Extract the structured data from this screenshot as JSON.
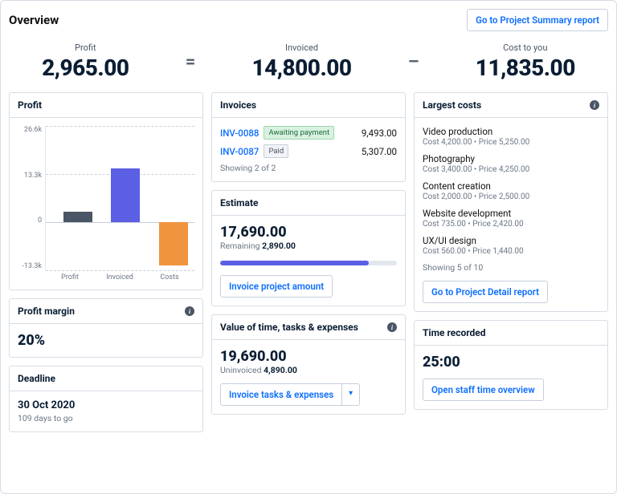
{
  "header": {
    "title": "Overview",
    "summary_btn": "Go to Project Summary report"
  },
  "metrics": {
    "profit_label": "Profit",
    "profit_value": "2,965.00",
    "eq": "=",
    "invoiced_label": "Invoiced",
    "invoiced_value": "14,800.00",
    "minus": "–",
    "cost_label": "Cost to you",
    "cost_value": "11,835.00"
  },
  "profit_chart": {
    "title": "Profit"
  },
  "chart_data": {
    "type": "bar",
    "categories": [
      "Profit",
      "Invoiced",
      "Costs"
    ],
    "values": [
      2965,
      14800,
      -11835
    ],
    "colors": [
      "#4a5566",
      "#5b5fe3",
      "#f0943f"
    ],
    "y_ticks": [
      "26.6k",
      "13.3k",
      "0",
      "-13.3k"
    ],
    "ylim": [
      -13300,
      26600
    ],
    "zero_frac": 0.333,
    "bars": [
      {
        "left_pct": 12,
        "bottom_pct": 33.3,
        "height_pct": 7.4,
        "color": "#4a5566"
      },
      {
        "left_pct": 44,
        "bottom_pct": 33.3,
        "height_pct": 37.1,
        "color": "#5b5fe3"
      },
      {
        "left_pct": 76,
        "bottom_pct": 3.6,
        "height_pct": 29.7,
        "color": "#f0943f"
      }
    ]
  },
  "profit_margin": {
    "title": "Profit margin",
    "value": "20%"
  },
  "deadline": {
    "title": "Deadline",
    "date": "30 Oct 2020",
    "remaining": "109 days to go"
  },
  "invoices": {
    "title": "Invoices",
    "rows": [
      {
        "ref": "INV-0088",
        "status": "Awaiting payment",
        "status_style": "green",
        "amount": "9,493.00"
      },
      {
        "ref": "INV-0087",
        "status": "Paid",
        "status_style": "gray",
        "amount": "5,307.00"
      }
    ],
    "showing": "Showing 2 of 2"
  },
  "estimate": {
    "title": "Estimate",
    "amount": "17,690.00",
    "remaining_label": "Remaining",
    "remaining_value": "2,890.00",
    "progress_pct": 84,
    "btn": "Invoice project amount"
  },
  "vtte": {
    "title": "Value of time, tasks & expenses",
    "amount": "19,690.00",
    "uninvoiced_label": "Uninvoiced",
    "uninvoiced_value": "4,890.00",
    "btn": "Invoice tasks & expenses"
  },
  "largest_costs": {
    "title": "Largest costs",
    "items": [
      {
        "name": "Video production",
        "sub": "Cost 4,200.00 • Price 5,250.00"
      },
      {
        "name": "Photography",
        "sub": "Cost 3,400.00 • Price 4,250.00"
      },
      {
        "name": "Content creation",
        "sub": "Cost 2,000.00 • Price 2,500.00"
      },
      {
        "name": "Website development",
        "sub": "Cost 735.00 • Price 2,420.00"
      },
      {
        "name": "UX/UI design",
        "sub": "Cost 560.00 • Price 1,440.00"
      }
    ],
    "showing": "Showing 5 of 10",
    "btn": "Go to Project Detail report"
  },
  "time_recorded": {
    "title": "Time recorded",
    "value": "25:00",
    "btn": "Open staff time overview"
  }
}
